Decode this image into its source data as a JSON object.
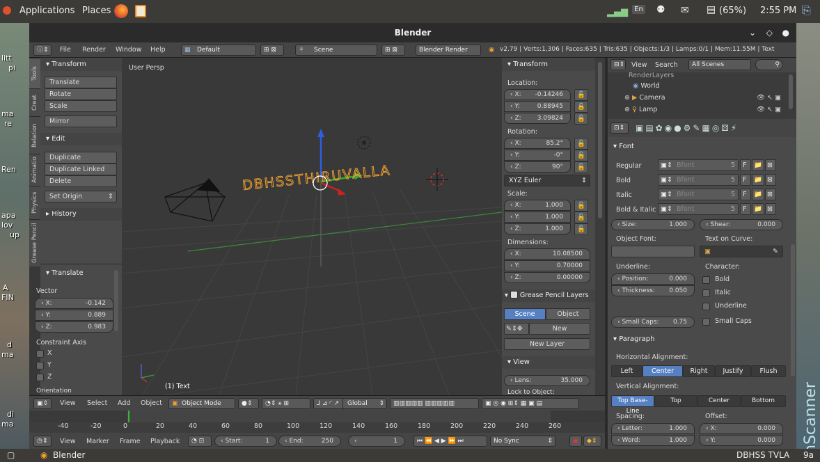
{
  "topbar": {
    "applications": "Applications",
    "places": "Places",
    "lang": "En",
    "battery": "(65%)",
    "time": "2:55 PM"
  },
  "window": {
    "title": "Blender"
  },
  "menubar": {
    "file": "File",
    "render": "Render",
    "window": "Window",
    "help": "Help",
    "layout": "Default",
    "scene": "Scene",
    "engine": "Blender Render",
    "stats": "v2.79 | Verts:1,306 | Faces:635 | Tris:635 | Objects:1/3 | Lamps:0/1 | Mem:11.55M | Text"
  },
  "lefttabs": [
    "Tools",
    "Creat",
    "Relation",
    "Animatio",
    "Physics",
    "Grease Pencil"
  ],
  "tools": {
    "transform_header": "Transform",
    "translate": "Translate",
    "rotate": "Rotate",
    "scale": "Scale",
    "mirror": "Mirror",
    "edit_header": "Edit",
    "duplicate": "Duplicate",
    "duplicate_linked": "Duplicate Linked",
    "delete": "Delete",
    "set_origin": "Set Origin",
    "history_header": "History",
    "op_header": "Translate",
    "vector": "Vector",
    "vx_label": "X:",
    "vx": "-0.142",
    "vy_label": "Y:",
    "vy": "0.889",
    "vz_label": "Z:",
    "vz": "0.983",
    "constraint": "Constraint Axis",
    "cx": "X",
    "cy": "Y",
    "cz": "Z",
    "orientation": "Orientation"
  },
  "viewport": {
    "label": "User Persp",
    "object": "(1) Text",
    "text3d": "DBHSSTHIRUVALLA"
  },
  "npanel": {
    "transform": "Transform",
    "location": "Location:",
    "loc": [
      {
        "l": "X:",
        "v": "-0.14246"
      },
      {
        "l": "Y:",
        "v": "0.88945"
      },
      {
        "l": "Z:",
        "v": "3.09824"
      }
    ],
    "rotation": "Rotation:",
    "rot": [
      {
        "l": "X:",
        "v": "85.2°"
      },
      {
        "l": "Y:",
        "v": "-0°"
      },
      {
        "l": "Z:",
        "v": "90°"
      }
    ],
    "rotmode": "XYZ Euler",
    "scale": "Scale:",
    "scl": [
      {
        "l": "X:",
        "v": "1.000"
      },
      {
        "l": "Y:",
        "v": "1.000"
      },
      {
        "l": "Z:",
        "v": "1.000"
      }
    ],
    "dimensions": "Dimensions:",
    "dim": [
      {
        "l": "X:",
        "v": "10.08500"
      },
      {
        "l": "Y:",
        "v": "0.70000"
      },
      {
        "l": "Z:",
        "v": "0.00000"
      }
    ],
    "gp_layers": "Grease Pencil Layers",
    "scene_btn": "Scene",
    "object_btn": "Object",
    "new": "New",
    "new_layer": "New Layer",
    "view": "View",
    "lens_label": "Lens:",
    "lens": "35.000",
    "lock": "Lock to Object:"
  },
  "outliner": {
    "view": "View",
    "search": "Search",
    "scenes": "All Scenes",
    "renderlayers": "RenderLayers",
    "world": "World",
    "camera": "Camera",
    "lamp": "Lamp"
  },
  "props": {
    "font_header": "Font",
    "regular": "Regular",
    "bold": "Bold",
    "italic": "Italic",
    "bolditalic": "Bold & Italic",
    "bfont": "Bfont",
    "users": "5",
    "fake": "F",
    "size_label": "Size:",
    "size": "1.000",
    "shear_label": "Shear:",
    "shear": "0.000",
    "objfont": "Object Font:",
    "textcurve": "Text on Curve:",
    "underline": "Underline:",
    "character": "Character:",
    "pos_label": "Position:",
    "pos": "0.000",
    "thick_label": "Thickness:",
    "thick": "0.050",
    "c_bold": "Bold",
    "c_italic": "Italic",
    "c_underline": "Underline",
    "smallcaps_label": "Small Caps:",
    "smallcaps": "0.75",
    "c_smallcaps": "Small Caps",
    "para_header": "Paragraph",
    "halign": "Horizontal Alignment:",
    "h_left": "Left",
    "h_center": "Center",
    "h_right": "Right",
    "h_justify": "Justify",
    "h_flush": "Flush",
    "valign": "Vertical Alignment:",
    "v_topbase": "Top Base-Line",
    "v_top": "Top",
    "v_center": "Center",
    "v_bottom": "Bottom",
    "spacing": "Spacing:",
    "offset": "Offset:",
    "letter_label": "Letter:",
    "letter": "1.000",
    "word_label": "Word:",
    "word": "1.000",
    "ox_label": "X:",
    "ox": "0.000",
    "oy_label": "Y:",
    "oy": "0.000"
  },
  "header3d": {
    "view": "View",
    "select": "Select",
    "add": "Add",
    "object": "Object",
    "mode": "Object Mode",
    "orient": "Global"
  },
  "timeline": {
    "ticks": [
      "-40",
      "-20",
      "0",
      "20",
      "40",
      "60",
      "80",
      "100",
      "120",
      "140",
      "160",
      "180",
      "200",
      "220",
      "240",
      "260"
    ],
    "view": "View",
    "marker": "Marker",
    "frame": "Frame",
    "playback": "Playback",
    "start_label": "Start:",
    "start": "1",
    "end_label": "End:",
    "end": "250",
    "current": "1",
    "sync": "No Sync"
  },
  "taskbar": {
    "app": "Blender",
    "workspace": "DBHSS TVLA",
    "extra": "9a"
  },
  "desktop": {
    "left_labels": [
      "litt",
      "pi",
      "ma",
      "re",
      "Ren",
      "apa",
      "lov",
      "up",
      "A",
      "FIN",
      "d",
      "ma",
      "di",
      "ma"
    ],
    "right_label": "nScanner"
  },
  "colors": {
    "accent": "#5680c2",
    "orange": "#f0a030",
    "select": "#ffa030"
  }
}
